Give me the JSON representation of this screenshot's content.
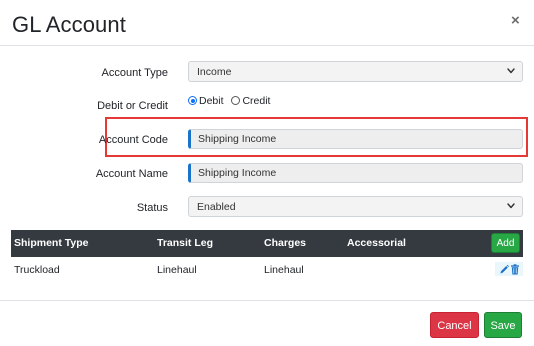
{
  "modal": {
    "title": "GL Account",
    "close_label": "×"
  },
  "form": {
    "account_type": {
      "label": "Account Type",
      "value": "Income"
    },
    "debit_credit": {
      "label": "Debit or Credit",
      "options": [
        "Debit",
        "Credit"
      ],
      "selected": "Debit"
    },
    "account_code": {
      "label": "Account Code",
      "value": "Shipping Income"
    },
    "account_name": {
      "label": "Account Name",
      "value": "Shipping Income"
    },
    "status": {
      "label": "Status",
      "value": "Enabled"
    }
  },
  "table": {
    "headers": [
      "Shipment Type",
      "Transit Leg",
      "Charges",
      "Accessorial"
    ],
    "add_label": "Add",
    "rows": [
      {
        "shipment_type": "Truckload",
        "transit_leg": "Linehaul",
        "charges": "Linehaul",
        "accessorial": ""
      }
    ]
  },
  "footer": {
    "cancel_label": "Cancel",
    "save_label": "Save"
  },
  "colors": {
    "primary": "#1a73c9",
    "danger": "#dc3545",
    "success": "#28a745",
    "table_header": "#343a40",
    "highlight": "#e53935"
  },
  "icons": {
    "close": "close-icon",
    "chevron": "chevron-down-icon",
    "edit": "pencil-icon",
    "delete": "trash-icon"
  }
}
